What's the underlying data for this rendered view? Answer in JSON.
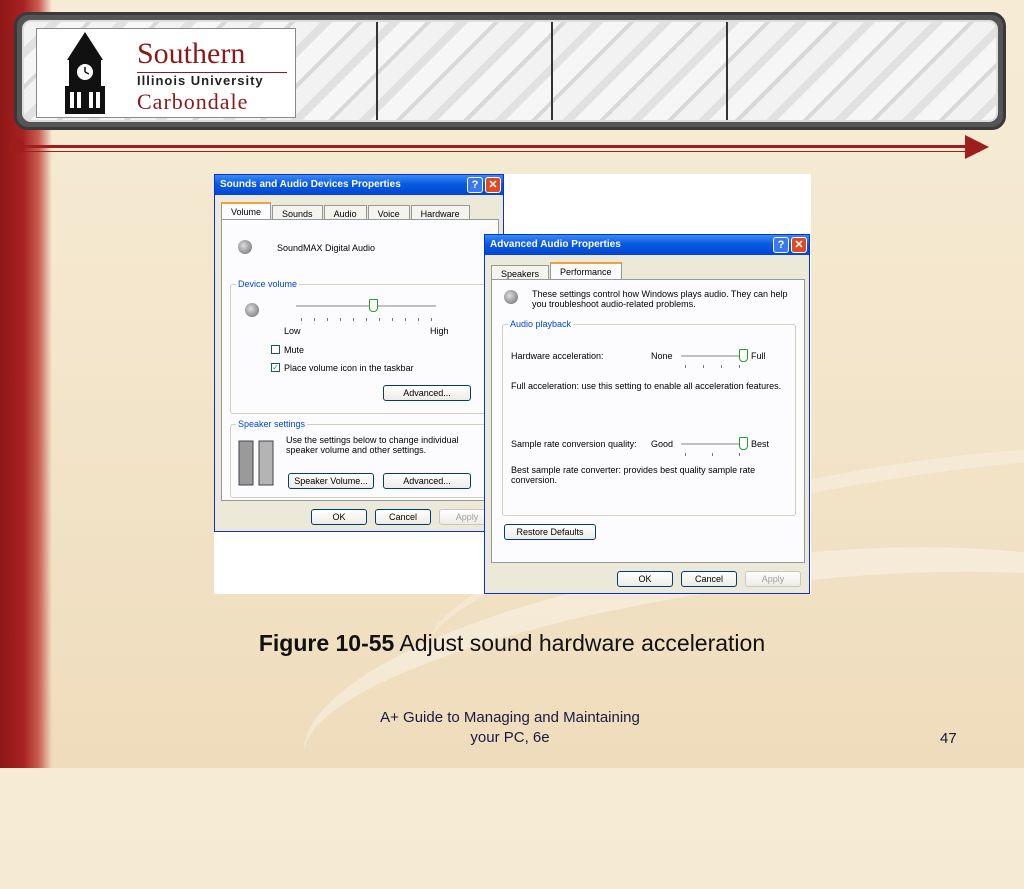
{
  "logo": {
    "line1": "Southern",
    "line2": "Illinois University",
    "line3": "Carbondale"
  },
  "colors": {
    "accent": "#9e1d1d",
    "xp_title": "#0a5ae0",
    "xp_face": "#ece9d8"
  },
  "sound_dialog": {
    "title": "Sounds and Audio Devices Properties",
    "help": "?",
    "close": "✕",
    "tabs": [
      "Volume",
      "Sounds",
      "Audio",
      "Voice",
      "Hardware"
    ],
    "device_name": "SoundMAX Digital Audio",
    "device_volume_label": "Device volume",
    "low": "Low",
    "high": "High",
    "mute": "Mute",
    "place_icon": "Place volume icon in the taskbar",
    "advanced1": "Advanced...",
    "speaker_settings_label": "Speaker settings",
    "speaker_text": "Use the settings below to change individual speaker volume and other settings.",
    "speaker_volume": "Speaker Volume...",
    "advanced2": "Advanced...",
    "ok": "OK",
    "cancel": "Cancel",
    "apply": "Apply",
    "volume_level": 0.55,
    "mute_checked": false,
    "place_icon_checked": true
  },
  "advanced_dialog": {
    "title": "Advanced Audio Properties",
    "help": "?",
    "close": "✕",
    "tabs": [
      "Speakers",
      "Performance"
    ],
    "intro": "These settings control how Windows plays audio. They can help you troubleshoot audio-related problems.",
    "group_label": "Audio playback",
    "hw_accel_label": "Hardware acceleration:",
    "hw_none": "None",
    "hw_full": "Full",
    "hw_desc": "Full acceleration: use this setting to enable all acceleration features.",
    "src_label": "Sample rate conversion quality:",
    "src_good": "Good",
    "src_best": "Best",
    "src_desc": "Best sample rate converter:  provides best quality sample rate conversion.",
    "restore": "Restore Defaults",
    "ok": "OK",
    "cancel": "Cancel",
    "apply": "Apply",
    "hw_level": 1.0,
    "src_level": 1.0
  },
  "caption": {
    "figure": "Figure 10-55",
    "text": " Adjust sound hardware acceleration"
  },
  "footer": {
    "line1": "A+ Guide to Managing and Maintaining",
    "line2": "your PC, 6e",
    "page": "47"
  }
}
